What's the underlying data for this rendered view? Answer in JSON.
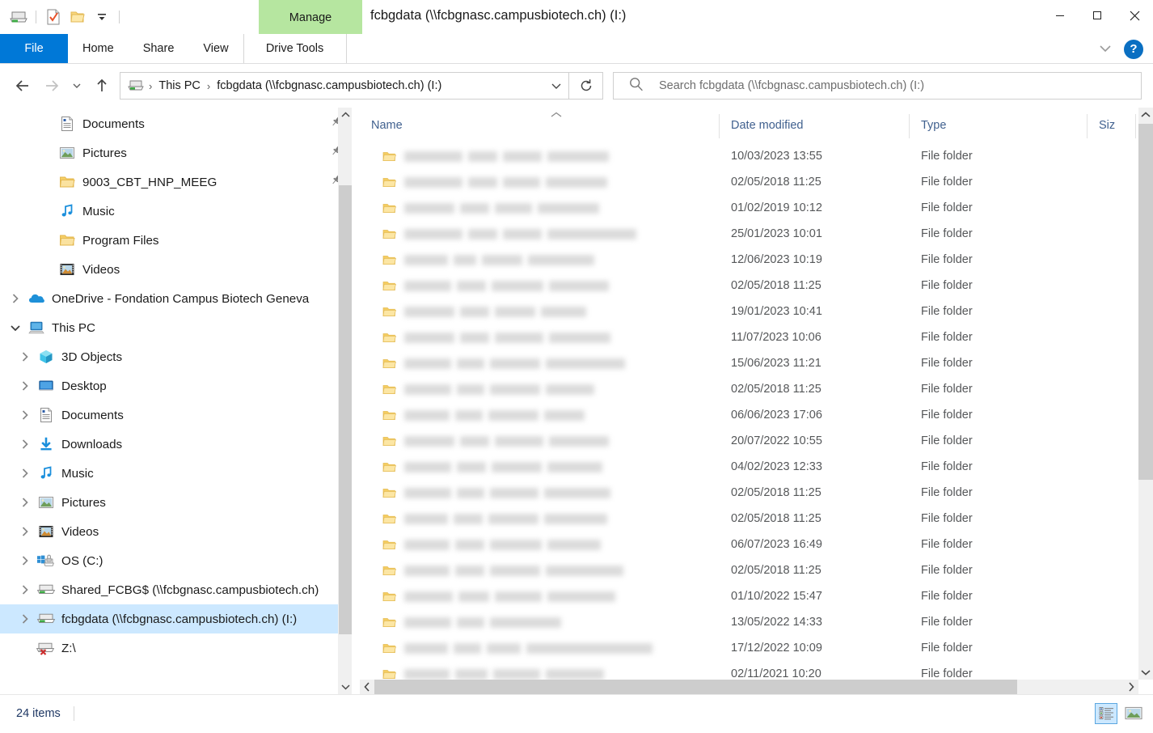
{
  "window": {
    "title": "fcbgdata (\\\\fcbgnasc.campusbiotech.ch) (I:)",
    "contextual_tab_label": "Manage",
    "minimize_label": "Minimize",
    "maximize_label": "Maximize",
    "close_label": "Close"
  },
  "quick_access_toolbar": {
    "items": [
      {
        "name": "drive-icon",
        "label": "Network Drive"
      },
      {
        "name": "properties-icon",
        "label": "Properties"
      },
      {
        "name": "new-folder-icon",
        "label": "New folder"
      },
      {
        "name": "customize-dropdown-icon",
        "label": "Customize Quick Access Toolbar"
      }
    ]
  },
  "ribbon": {
    "tabs": [
      {
        "id": "file",
        "label": "File",
        "active": true
      },
      {
        "id": "home",
        "label": "Home",
        "active": false
      },
      {
        "id": "share",
        "label": "Share",
        "active": false
      },
      {
        "id": "view",
        "label": "View",
        "active": false
      },
      {
        "id": "drive-tools",
        "label": "Drive Tools",
        "active": false
      }
    ],
    "expand_label": "Expand the Ribbon",
    "help_label": "?"
  },
  "navigation": {
    "back_label": "Back",
    "forward_label": "Forward",
    "recent_label": "Recent locations",
    "up_label": "Up to This PC",
    "refresh_label": "Refresh",
    "address_dropdown_label": "Previous Locations",
    "breadcrumbs": [
      {
        "label": "This PC"
      },
      {
        "label": "fcbgdata (\\\\fcbgnasc.campusbiotech.ch) (I:)"
      }
    ]
  },
  "search": {
    "placeholder": "Search fcbgdata (\\\\fcbgnasc.campusbiotech.ch) (I:)",
    "icon": "search-icon"
  },
  "sidebar": {
    "items": [
      {
        "label": "Documents",
        "icon": "documents-icon",
        "indent": 2,
        "twisty": "",
        "pinned": true,
        "selected": false
      },
      {
        "label": "Pictures",
        "icon": "pictures-icon",
        "indent": 2,
        "twisty": "",
        "pinned": true,
        "selected": false
      },
      {
        "label": "9003_CBT_HNP_MEEG",
        "icon": "folder-icon",
        "indent": 2,
        "twisty": "",
        "pinned": true,
        "selected": false
      },
      {
        "label": "Music",
        "icon": "music-icon",
        "indent": 2,
        "twisty": "",
        "pinned": false,
        "selected": false
      },
      {
        "label": "Program Files",
        "icon": "folder-icon",
        "indent": 2,
        "twisty": "",
        "pinned": false,
        "selected": false
      },
      {
        "label": "Videos",
        "icon": "videos-icon",
        "indent": 2,
        "twisty": "",
        "pinned": false,
        "selected": false
      },
      {
        "label": "OneDrive - Fondation Campus Biotech Geneva",
        "icon": "onedrive-icon",
        "indent": 0,
        "twisty": "collapsed",
        "pinned": false,
        "selected": false
      },
      {
        "label": "This PC",
        "icon": "thispc-icon",
        "indent": 0,
        "twisty": "expanded",
        "pinned": false,
        "selected": false
      },
      {
        "label": "3D Objects",
        "icon": "3dobjects-icon",
        "indent": 1,
        "twisty": "collapsed",
        "pinned": false,
        "selected": false
      },
      {
        "label": "Desktop",
        "icon": "desktop-icon",
        "indent": 1,
        "twisty": "collapsed",
        "pinned": false,
        "selected": false
      },
      {
        "label": "Documents",
        "icon": "documents-icon",
        "indent": 1,
        "twisty": "collapsed",
        "pinned": false,
        "selected": false
      },
      {
        "label": "Downloads",
        "icon": "downloads-icon",
        "indent": 1,
        "twisty": "collapsed",
        "pinned": false,
        "selected": false
      },
      {
        "label": "Music",
        "icon": "music-icon",
        "indent": 1,
        "twisty": "collapsed",
        "pinned": false,
        "selected": false
      },
      {
        "label": "Pictures",
        "icon": "pictures-icon",
        "indent": 1,
        "twisty": "collapsed",
        "pinned": false,
        "selected": false
      },
      {
        "label": "Videos",
        "icon": "videos-icon",
        "indent": 1,
        "twisty": "collapsed",
        "pinned": false,
        "selected": false
      },
      {
        "label": "OS (C:)",
        "icon": "oswindows-drive-icon",
        "indent": 1,
        "twisty": "collapsed",
        "pinned": false,
        "selected": false
      },
      {
        "label": "Shared_FCBG$ (\\\\fcbgnasc.campusbiotech.ch)",
        "icon": "network-drive-icon",
        "indent": 1,
        "twisty": "collapsed",
        "pinned": false,
        "selected": false
      },
      {
        "label": "fcbgdata (\\\\fcbgnasc.campusbiotech.ch) (I:)",
        "icon": "network-drive-icon",
        "indent": 1,
        "twisty": "collapsed",
        "pinned": false,
        "selected": true
      },
      {
        "label": "Z:\\",
        "icon": "disconnected-drive-icon",
        "indent": 1,
        "twisty": "",
        "pinned": false,
        "selected": false
      }
    ]
  },
  "filelist": {
    "columns": [
      {
        "key": "name",
        "label": "Name",
        "sorted": "asc"
      },
      {
        "key": "date",
        "label": "Date modified",
        "sorted": ""
      },
      {
        "key": "type",
        "label": "Type",
        "sorted": ""
      },
      {
        "key": "size",
        "label": "Siz",
        "sorted": ""
      }
    ],
    "rows": [
      {
        "name": "",
        "name_redacted": true,
        "name_widths": [
          72,
          36,
          48,
          76
        ],
        "date": "10/03/2023 13:55",
        "type": "File folder",
        "size": ""
      },
      {
        "name": "",
        "name_redacted": true,
        "name_widths": [
          72,
          36,
          46,
          76
        ],
        "date": "02/05/2018 11:25",
        "type": "File folder",
        "size": ""
      },
      {
        "name": "",
        "name_redacted": true,
        "name_widths": [
          62,
          36,
          46,
          76
        ],
        "date": "01/02/2019 10:12",
        "type": "File folder",
        "size": ""
      },
      {
        "name": "",
        "name_redacted": true,
        "name_widths": [
          72,
          36,
          48,
          110
        ],
        "date": "25/01/2023 10:01",
        "type": "File folder",
        "size": ""
      },
      {
        "name": "",
        "name_redacted": true,
        "name_widths": [
          54,
          28,
          50,
          82
        ],
        "date": "12/06/2023 10:19",
        "type": "File folder",
        "size": ""
      },
      {
        "name": "",
        "name_redacted": true,
        "name_widths": [
          58,
          36,
          64,
          74
        ],
        "date": "02/05/2018 11:25",
        "type": "File folder",
        "size": ""
      },
      {
        "name": "",
        "name_redacted": true,
        "name_widths": [
          62,
          36,
          50,
          56
        ],
        "date": "19/01/2023 10:41",
        "type": "File folder",
        "size": ""
      },
      {
        "name": "",
        "name_redacted": true,
        "name_widths": [
          62,
          36,
          60,
          76
        ],
        "date": "11/07/2023 10:06",
        "type": "File folder",
        "size": ""
      },
      {
        "name": "",
        "name_redacted": true,
        "name_widths": [
          58,
          34,
          62,
          98
        ],
        "date": "15/06/2023 11:21",
        "type": "File folder",
        "size": ""
      },
      {
        "name": "",
        "name_redacted": true,
        "name_widths": [
          58,
          34,
          62,
          60
        ],
        "date": "02/05/2018 11:25",
        "type": "File folder",
        "size": ""
      },
      {
        "name": "",
        "name_redacted": true,
        "name_widths": [
          56,
          34,
          62,
          50
        ],
        "date": "06/06/2023 17:06",
        "type": "File folder",
        "size": ""
      },
      {
        "name": "",
        "name_redacted": true,
        "name_widths": [
          62,
          36,
          60,
          74
        ],
        "date": "20/07/2022 10:55",
        "type": "File folder",
        "size": ""
      },
      {
        "name": "",
        "name_redacted": true,
        "name_widths": [
          58,
          36,
          62,
          68
        ],
        "date": "04/02/2023 12:33",
        "type": "File folder",
        "size": ""
      },
      {
        "name": "",
        "name_redacted": true,
        "name_widths": [
          58,
          34,
          60,
          82
        ],
        "date": "02/05/2018 11:25",
        "type": "File folder",
        "size": ""
      },
      {
        "name": "",
        "name_redacted": true,
        "name_widths": [
          54,
          36,
          62,
          78
        ],
        "date": "02/05/2018 11:25",
        "type": "File folder",
        "size": ""
      },
      {
        "name": "",
        "name_redacted": true,
        "name_widths": [
          56,
          36,
          64,
          66
        ],
        "date": "06/07/2023 16:49",
        "type": "File folder",
        "size": ""
      },
      {
        "name": "",
        "name_redacted": true,
        "name_widths": [
          56,
          36,
          62,
          96
        ],
        "date": "02/05/2018 11:25",
        "type": "File folder",
        "size": ""
      },
      {
        "name": "",
        "name_redacted": true,
        "name_widths": [
          60,
          38,
          58,
          84
        ],
        "date": "01/10/2022 15:47",
        "type": "File folder",
        "size": ""
      },
      {
        "name": "",
        "name_redacted": true,
        "name_widths": [
          58,
          34,
          88,
          0
        ],
        "date": "13/05/2022 14:33",
        "type": "File folder",
        "size": ""
      },
      {
        "name": "",
        "name_redacted": true,
        "name_widths": [
          54,
          34,
          42,
          156
        ],
        "date": "17/12/2022 10:09",
        "type": "File folder",
        "size": ""
      },
      {
        "name": "",
        "name_redacted": true,
        "name_widths": [
          56,
          40,
          58,
          72
        ],
        "date": "02/11/2021 10:20",
        "type": "File folder",
        "size": ""
      }
    ]
  },
  "statusbar": {
    "item_count": "24 items",
    "view_details_label": "Details view",
    "view_largeicons_label": "Large icons view"
  }
}
